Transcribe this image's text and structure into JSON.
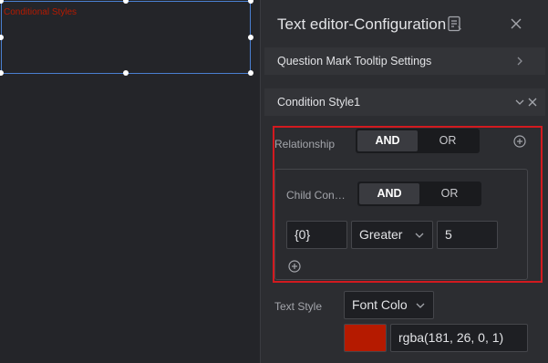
{
  "canvas": {
    "widget_text": "Conditional Styles",
    "widget_text_color": "#b51a00"
  },
  "panel": {
    "title": "Text editor-Configuration",
    "icons": {
      "doc": "document-settings-icon",
      "close": "close-icon"
    },
    "tooltip_section": {
      "label": "Question Mark Tooltip Settings",
      "icon": "chevron-right-icon"
    },
    "condition_section": {
      "label": "Condition Style1",
      "icons": [
        "chevron-down-icon",
        "close-icon"
      ],
      "relationship": {
        "label": "Relationship",
        "options": [
          "AND",
          "OR"
        ],
        "selected": "AND"
      },
      "child": {
        "label": "Child Con…",
        "options": [
          "AND",
          "OR"
        ],
        "selected": "AND",
        "field": "{0}",
        "operator": "Greater",
        "value": "5"
      }
    },
    "text_style": {
      "label": "Text Style",
      "property": "Font Colo",
      "color_value": "rgba(181, 26, 0, 1)",
      "swatch_color": "#b51a00"
    }
  },
  "colors": {
    "highlight_border": "#d21a1f",
    "selection_border": "#4a7fd0"
  }
}
